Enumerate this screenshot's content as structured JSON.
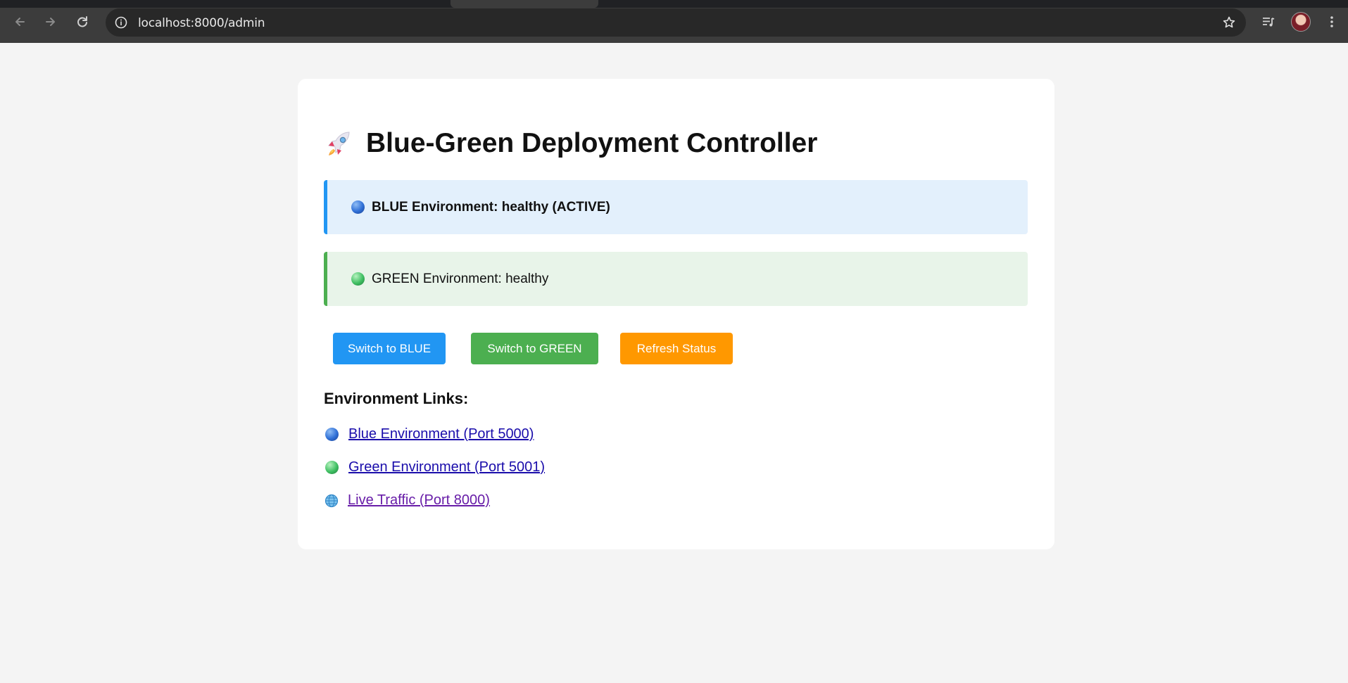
{
  "browser": {
    "url": "localhost:8000/admin",
    "icons": [
      "back-arrow-icon",
      "forward-arrow-icon",
      "reload-icon",
      "site-info-icon",
      "bookmark-star-icon",
      "media-controls-icon",
      "profile-avatar",
      "more-menu-icon"
    ]
  },
  "page": {
    "title": "Blue-Green Deployment Controller",
    "title_icon": "rocket-icon",
    "environments": [
      {
        "name": "blue",
        "text": "BLUE Environment: healthy (ACTIVE)",
        "color": "#2196f3",
        "background": "#e3f0fc"
      },
      {
        "name": "green",
        "text": "GREEN Environment: healthy",
        "color": "#4caf50",
        "background": "#e8f4e9"
      }
    ],
    "buttons": [
      {
        "label": "Switch to BLUE",
        "color": "#2196f3"
      },
      {
        "label": "Switch to GREEN",
        "color": "#4caf50"
      },
      {
        "label": "Refresh Status",
        "color": "#ff9800"
      }
    ],
    "links_heading": "Environment Links:",
    "links": [
      {
        "label": "Blue Environment (Port 5000)",
        "icon": "blue-circle-icon"
      },
      {
        "label": "Green Environment (Port 5001)",
        "icon": "green-circle-icon"
      },
      {
        "label": "Live Traffic (Port 8000)",
        "icon": "globe-icon",
        "visited": true
      }
    ]
  }
}
